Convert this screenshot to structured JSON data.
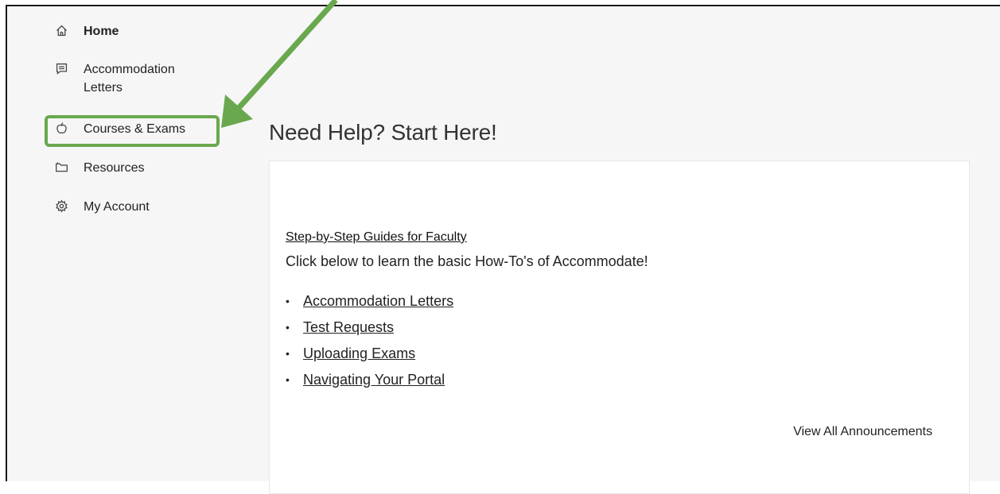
{
  "sidebar": {
    "items": [
      {
        "label": "Home",
        "icon": "home-icon"
      },
      {
        "label": "Accommodation Letters",
        "icon": "chat-list-icon"
      },
      {
        "label": "Courses & Exams",
        "icon": "apple-icon"
      },
      {
        "label": "Resources",
        "icon": "folder-icon"
      },
      {
        "label": "My Account",
        "icon": "gear-icon"
      }
    ]
  },
  "main": {
    "heading": "Need Help? Start Here!",
    "card": {
      "guide_title": "Step-by-Step Guides for Faculty",
      "guide_description": "Click below to learn the basic How-To's of Accommodate!",
      "links": [
        "Accommodation Letters",
        "Test Requests",
        "Uploading Exams",
        "Navigating Your Portal"
      ],
      "view_all": "View All Announcements"
    }
  },
  "annotation": {
    "highlight_color": "#6aa84f",
    "arrow_color": "#6aa84f"
  }
}
